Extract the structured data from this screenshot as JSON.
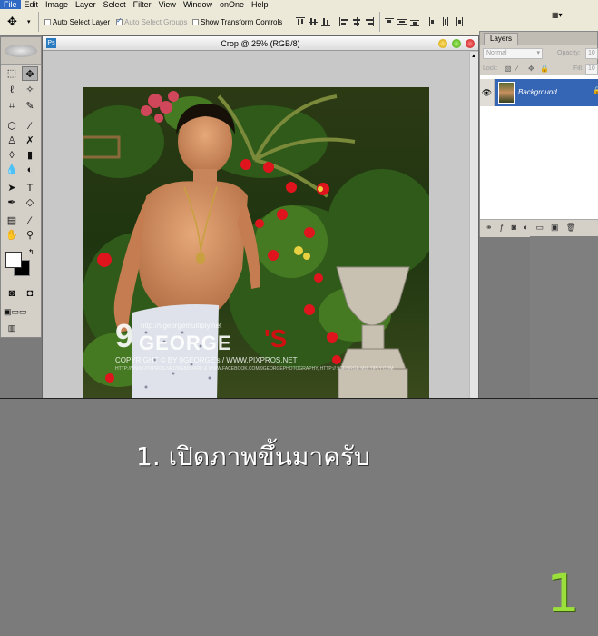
{
  "menu": [
    "File",
    "Edit",
    "Image",
    "Layer",
    "Select",
    "Filter",
    "View",
    "Window",
    "onOne",
    "Help"
  ],
  "options": {
    "auto_select_layer": "Auto Select Layer",
    "auto_select_groups": "Auto Select Groups",
    "show_transform_controls": "Show Transform Controls"
  },
  "document": {
    "title": "Crop @ 25% (RGB/8)"
  },
  "layers": {
    "tab": "Layers",
    "blend_mode": "Normal",
    "opacity_label": "Opacity:",
    "opacity_value": "10",
    "lock_label": "Lock:",
    "fill_label": "Fill:",
    "fill_value": "10",
    "layer_name": "Background"
  },
  "watermark": {
    "url": "http://9georgemultiply.net",
    "brand_9": "9",
    "brand_main": "GEORGE",
    "brand_s": "'S",
    "copyright": "COPYRIGHT © BY 9GEORGE's / WWW.PIXPROS.NET",
    "footer": "HTTP://WWW.PIXPROS.NET/WEBBOARD & WWW.FACEBOOK.COM/9GEORGEPHOTOGRAPHY, HTTP:// 9GEORGE.MULTIPLY.COM"
  },
  "caption": {
    "text": "1. เปิดภาพขึ้นมาครับ",
    "step": "1"
  },
  "colors": {
    "accent_step": "#9be03a",
    "layer_selected": "#3565b5"
  }
}
